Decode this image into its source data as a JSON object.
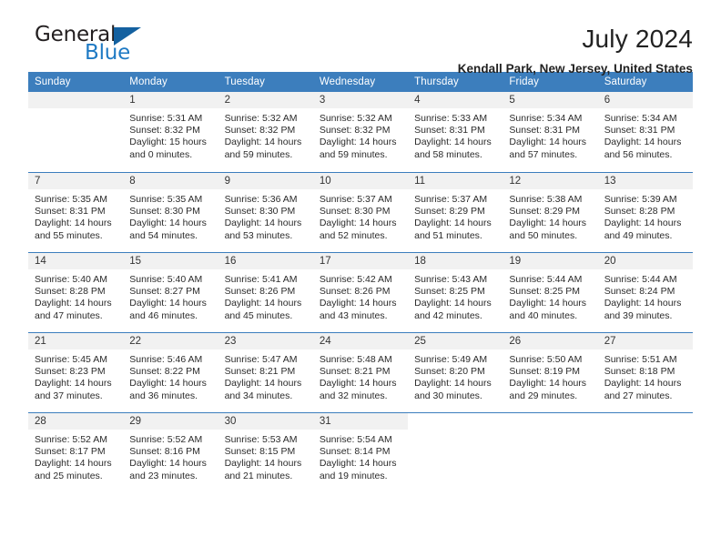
{
  "brand": {
    "name_part1": "General",
    "name_part2": "Blue"
  },
  "header": {
    "month_title": "July 2024",
    "location": "Kendall Park, New Jersey, United States"
  },
  "colors": {
    "header_blue": "#3c7ebd",
    "logo_blue": "#1f7ac4",
    "daynum_background": "#f1f1f1"
  },
  "calendar": {
    "weekday_headers": [
      "Sunday",
      "Monday",
      "Tuesday",
      "Wednesday",
      "Thursday",
      "Friday",
      "Saturday"
    ],
    "weeks": [
      [
        {
          "day": "",
          "sunrise": "",
          "sunset": "",
          "daylight": "",
          "empty": true
        },
        {
          "day": "1",
          "sunrise": "Sunrise: 5:31 AM",
          "sunset": "Sunset: 8:32 PM",
          "daylight": "Daylight: 15 hours and 0 minutes."
        },
        {
          "day": "2",
          "sunrise": "Sunrise: 5:32 AM",
          "sunset": "Sunset: 8:32 PM",
          "daylight": "Daylight: 14 hours and 59 minutes."
        },
        {
          "day": "3",
          "sunrise": "Sunrise: 5:32 AM",
          "sunset": "Sunset: 8:32 PM",
          "daylight": "Daylight: 14 hours and 59 minutes."
        },
        {
          "day": "4",
          "sunrise": "Sunrise: 5:33 AM",
          "sunset": "Sunset: 8:31 PM",
          "daylight": "Daylight: 14 hours and 58 minutes."
        },
        {
          "day": "5",
          "sunrise": "Sunrise: 5:34 AM",
          "sunset": "Sunset: 8:31 PM",
          "daylight": "Daylight: 14 hours and 57 minutes."
        },
        {
          "day": "6",
          "sunrise": "Sunrise: 5:34 AM",
          "sunset": "Sunset: 8:31 PM",
          "daylight": "Daylight: 14 hours and 56 minutes."
        }
      ],
      [
        {
          "day": "7",
          "sunrise": "Sunrise: 5:35 AM",
          "sunset": "Sunset: 8:31 PM",
          "daylight": "Daylight: 14 hours and 55 minutes."
        },
        {
          "day": "8",
          "sunrise": "Sunrise: 5:35 AM",
          "sunset": "Sunset: 8:30 PM",
          "daylight": "Daylight: 14 hours and 54 minutes."
        },
        {
          "day": "9",
          "sunrise": "Sunrise: 5:36 AM",
          "sunset": "Sunset: 8:30 PM",
          "daylight": "Daylight: 14 hours and 53 minutes."
        },
        {
          "day": "10",
          "sunrise": "Sunrise: 5:37 AM",
          "sunset": "Sunset: 8:30 PM",
          "daylight": "Daylight: 14 hours and 52 minutes."
        },
        {
          "day": "11",
          "sunrise": "Sunrise: 5:37 AM",
          "sunset": "Sunset: 8:29 PM",
          "daylight": "Daylight: 14 hours and 51 minutes."
        },
        {
          "day": "12",
          "sunrise": "Sunrise: 5:38 AM",
          "sunset": "Sunset: 8:29 PM",
          "daylight": "Daylight: 14 hours and 50 minutes."
        },
        {
          "day": "13",
          "sunrise": "Sunrise: 5:39 AM",
          "sunset": "Sunset: 8:28 PM",
          "daylight": "Daylight: 14 hours and 49 minutes."
        }
      ],
      [
        {
          "day": "14",
          "sunrise": "Sunrise: 5:40 AM",
          "sunset": "Sunset: 8:28 PM",
          "daylight": "Daylight: 14 hours and 47 minutes."
        },
        {
          "day": "15",
          "sunrise": "Sunrise: 5:40 AM",
          "sunset": "Sunset: 8:27 PM",
          "daylight": "Daylight: 14 hours and 46 minutes."
        },
        {
          "day": "16",
          "sunrise": "Sunrise: 5:41 AM",
          "sunset": "Sunset: 8:26 PM",
          "daylight": "Daylight: 14 hours and 45 minutes."
        },
        {
          "day": "17",
          "sunrise": "Sunrise: 5:42 AM",
          "sunset": "Sunset: 8:26 PM",
          "daylight": "Daylight: 14 hours and 43 minutes."
        },
        {
          "day": "18",
          "sunrise": "Sunrise: 5:43 AM",
          "sunset": "Sunset: 8:25 PM",
          "daylight": "Daylight: 14 hours and 42 minutes."
        },
        {
          "day": "19",
          "sunrise": "Sunrise: 5:44 AM",
          "sunset": "Sunset: 8:25 PM",
          "daylight": "Daylight: 14 hours and 40 minutes."
        },
        {
          "day": "20",
          "sunrise": "Sunrise: 5:44 AM",
          "sunset": "Sunset: 8:24 PM",
          "daylight": "Daylight: 14 hours and 39 minutes."
        }
      ],
      [
        {
          "day": "21",
          "sunrise": "Sunrise: 5:45 AM",
          "sunset": "Sunset: 8:23 PM",
          "daylight": "Daylight: 14 hours and 37 minutes."
        },
        {
          "day": "22",
          "sunrise": "Sunrise: 5:46 AM",
          "sunset": "Sunset: 8:22 PM",
          "daylight": "Daylight: 14 hours and 36 minutes."
        },
        {
          "day": "23",
          "sunrise": "Sunrise: 5:47 AM",
          "sunset": "Sunset: 8:21 PM",
          "daylight": "Daylight: 14 hours and 34 minutes."
        },
        {
          "day": "24",
          "sunrise": "Sunrise: 5:48 AM",
          "sunset": "Sunset: 8:21 PM",
          "daylight": "Daylight: 14 hours and 32 minutes."
        },
        {
          "day": "25",
          "sunrise": "Sunrise: 5:49 AM",
          "sunset": "Sunset: 8:20 PM",
          "daylight": "Daylight: 14 hours and 30 minutes."
        },
        {
          "day": "26",
          "sunrise": "Sunrise: 5:50 AM",
          "sunset": "Sunset: 8:19 PM",
          "daylight": "Daylight: 14 hours and 29 minutes."
        },
        {
          "day": "27",
          "sunrise": "Sunrise: 5:51 AM",
          "sunset": "Sunset: 8:18 PM",
          "daylight": "Daylight: 14 hours and 27 minutes."
        }
      ],
      [
        {
          "day": "28",
          "sunrise": "Sunrise: 5:52 AM",
          "sunset": "Sunset: 8:17 PM",
          "daylight": "Daylight: 14 hours and 25 minutes."
        },
        {
          "day": "29",
          "sunrise": "Sunrise: 5:52 AM",
          "sunset": "Sunset: 8:16 PM",
          "daylight": "Daylight: 14 hours and 23 minutes."
        },
        {
          "day": "30",
          "sunrise": "Sunrise: 5:53 AM",
          "sunset": "Sunset: 8:15 PM",
          "daylight": "Daylight: 14 hours and 21 minutes."
        },
        {
          "day": "31",
          "sunrise": "Sunrise: 5:54 AM",
          "sunset": "Sunset: 8:14 PM",
          "daylight": "Daylight: 14 hours and 19 minutes."
        },
        {
          "day": "",
          "sunrise": "",
          "sunset": "",
          "daylight": "",
          "empty": true,
          "blank": true
        },
        {
          "day": "",
          "sunrise": "",
          "sunset": "",
          "daylight": "",
          "empty": true,
          "blank": true
        },
        {
          "day": "",
          "sunrise": "",
          "sunset": "",
          "daylight": "",
          "empty": true,
          "blank": true
        }
      ]
    ]
  }
}
